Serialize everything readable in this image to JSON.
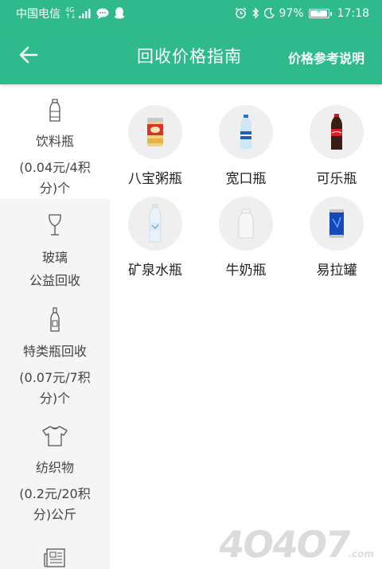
{
  "status_bar": {
    "carrier": "中国电信",
    "network": "4G",
    "battery": "97%",
    "battery_level": 0.97,
    "time": "17:18"
  },
  "header": {
    "title": "回收价格指南",
    "help_link": "价格参考说明"
  },
  "sidebar": {
    "categories": [
      {
        "icon": "bottle-icon",
        "name": "饮料瓶",
        "note": "(0.04元/4积分)个",
        "active": true
      },
      {
        "icon": "wine-glass-icon",
        "name": "玻璃",
        "note": "公益回收",
        "active": false
      },
      {
        "icon": "slim-bottle-icon",
        "name": "特类瓶回收",
        "note": "(0.07元/7积分)个",
        "active": false
      },
      {
        "icon": "tshirt-icon",
        "name": "纺织物",
        "note": "(0.2元/20积分)公斤",
        "active": false
      },
      {
        "icon": "newspaper-icon",
        "name": "",
        "note": "",
        "active": false
      }
    ]
  },
  "items": [
    {
      "label": "八宝粥瓶",
      "icon": "congee-can-icon"
    },
    {
      "label": "宽口瓶",
      "icon": "water-bottle-icon"
    },
    {
      "label": "可乐瓶",
      "icon": "cola-bottle-icon"
    },
    {
      "label": "矿泉水瓶",
      "icon": "mineral-water-bottle-icon"
    },
    {
      "label": "牛奶瓶",
      "icon": "milk-bottle-icon"
    },
    {
      "label": "易拉罐",
      "icon": "soda-can-icon"
    }
  ],
  "colors": {
    "brand": "#2eba8c",
    "sidebar_bg": "#f5f5f5",
    "circle_bg": "#efefef"
  }
}
